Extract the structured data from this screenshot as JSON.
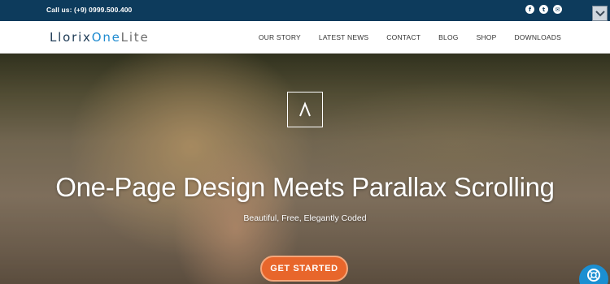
{
  "topbar": {
    "call_text": "Call us: (+9) 0999.500.400",
    "social": [
      {
        "glyph": "f",
        "icon": "facebook-icon"
      },
      {
        "glyph": "t",
        "icon": "twitter-icon"
      },
      {
        "glyph": "✉",
        "icon": "email-icon"
      }
    ]
  },
  "logo": {
    "part1": "Llorix",
    "part2": "One",
    "part3": "Lite"
  },
  "nav": {
    "items": [
      "OUR STORY",
      "LATEST NEWS",
      "CONTACT",
      "BLOG",
      "SHOP",
      "DOWNLOADS"
    ]
  },
  "hero": {
    "headline": "One-Page Design Meets Parallax Scrolling",
    "subheadline": "Beautiful, Free, Elegantly Coded",
    "cta_label": "GET STARTED"
  },
  "colors": {
    "topbar": "#0d3b5c",
    "accent": "#e8662b",
    "logo_blue": "#1f8bd0",
    "help_button": "#1b8fd2"
  }
}
